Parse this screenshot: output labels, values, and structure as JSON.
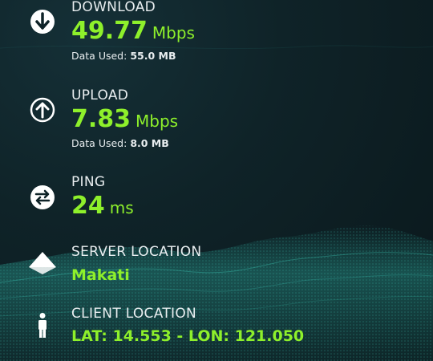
{
  "download": {
    "label": "DOWNLOAD",
    "value": "49.77",
    "unit": "Mbps",
    "data_used_label": "Data Used:",
    "data_used_value": "55.0 MB",
    "icon": "arrow-down-circle-icon"
  },
  "upload": {
    "label": "UPLOAD",
    "value": "7.83",
    "unit": "Mbps",
    "data_used_label": "Data Used:",
    "data_used_value": "8.0 MB",
    "icon": "arrow-up-circle-icon"
  },
  "ping": {
    "label": "PING",
    "value": "24",
    "unit": "ms",
    "icon": "ping-arrows-icon"
  },
  "server": {
    "label": "SERVER LOCATION",
    "value": "Makati",
    "icon": "server-diamond-icon"
  },
  "client": {
    "label": "CLIENT LOCATION",
    "value": "LAT: 14.553 - LON: 121.050",
    "icon": "person-icon"
  },
  "colors": {
    "accent": "#8ef02b",
    "text": "#e9eef0",
    "background": "#0f2328",
    "wave": "#2fb7a8"
  }
}
